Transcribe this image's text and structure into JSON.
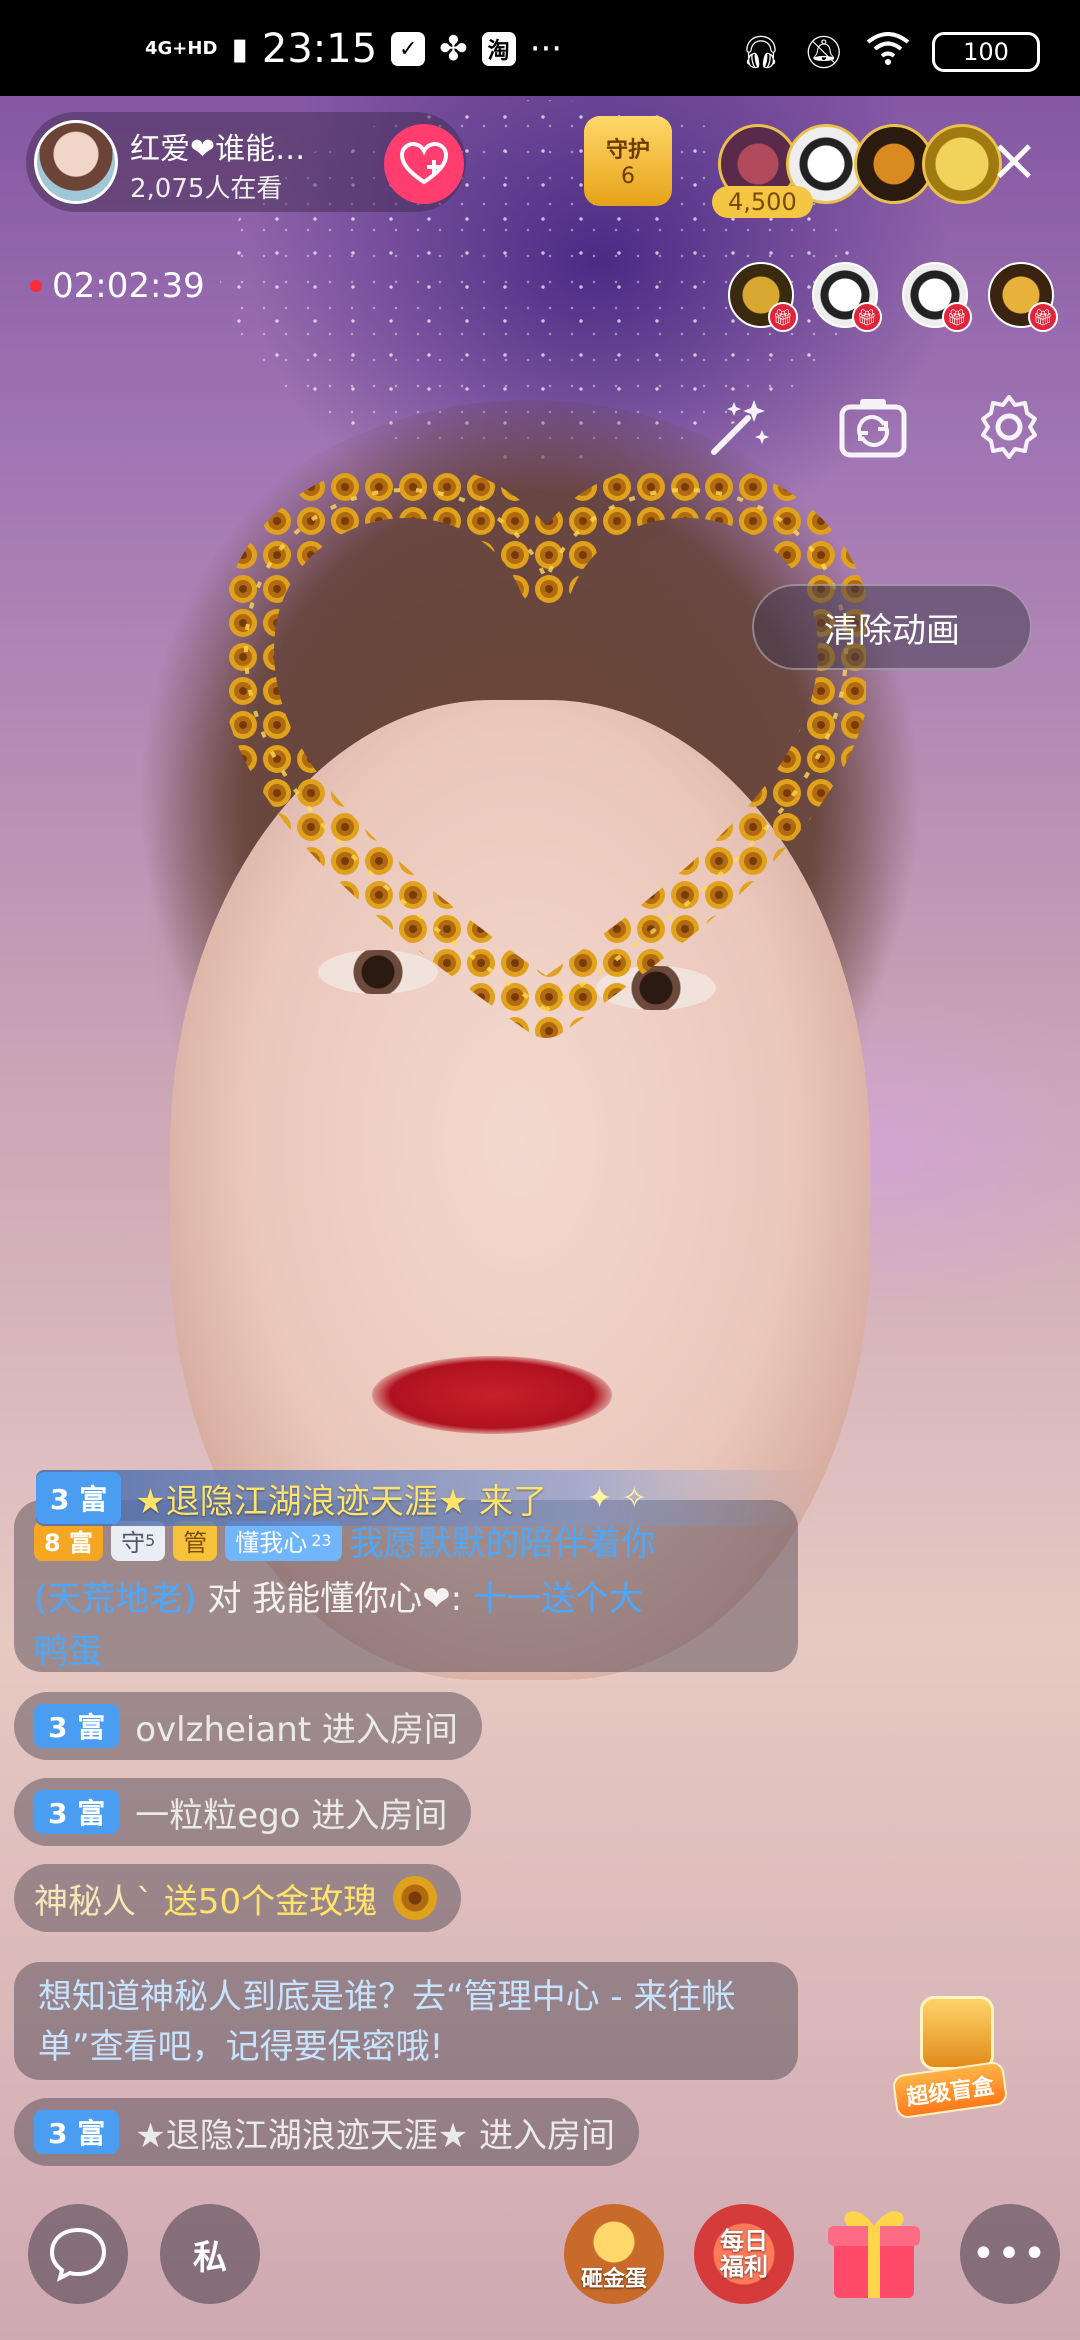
{
  "status_bar": {
    "network": "4G+HD",
    "time": "23:15",
    "app_icons": [
      "message-icon",
      "pinwheel-icon",
      "taobao-icon"
    ],
    "taobao_label": "淘",
    "more": "···",
    "battery": "100"
  },
  "host": {
    "name": "红爱❤谁能…",
    "viewers": "2,075人在看",
    "follow_icon": "heart-plus-icon"
  },
  "guard": {
    "label": "守护",
    "count": "6"
  },
  "top_fans": {
    "score": "4,500"
  },
  "live": {
    "timer": "02:02:39",
    "clear_animation": "清除动画"
  },
  "chat": {
    "entry_banner": {
      "level": "3 富",
      "text": "★退隐江湖浪迹天涯★ 来了"
    },
    "message": {
      "level": "8 富",
      "guard_badge": "守",
      "guard_level": "5",
      "admin_badge": "管",
      "fan_club": "懂我心",
      "fan_level": "23",
      "line1": "我愿默默的陪伴着你",
      "line2_blue": "(天荒地老)",
      "line2_mid": " 对 我能懂你心❤: ",
      "line2_tail": "十一送个大",
      "line3": "鸭蛋"
    },
    "enter_1": {
      "level": "3 富",
      "text": "ovlzheiant 进入房间"
    },
    "enter_2": {
      "level": "3 富",
      "text": "一粒粒ego 进入房间"
    },
    "gift": {
      "sender": "神秘人`",
      "text": " 送50个金玫瑰"
    },
    "system": "想知道神秘人到底是谁？去“管理中心 - 来往帐单”查看吧，记得要保密哦!",
    "enter_3": {
      "level": "3 富",
      "text": "★退隐江湖浪迹天涯★ 进入房间"
    }
  },
  "blind_box": "超级盲盒",
  "bottom_bar": {
    "chat_icon": "chat-bubble-icon",
    "private_label": "私",
    "egg_label": "砸金蛋",
    "daily_label": "每日福利",
    "more": "•••"
  },
  "colors": {
    "level_blue": "#4a9df0",
    "level_orange": "#f5a623",
    "follow_pink": "#ff3d6e",
    "link_blue": "#4aa9ff",
    "banner_yellow": "#ffe36a"
  }
}
